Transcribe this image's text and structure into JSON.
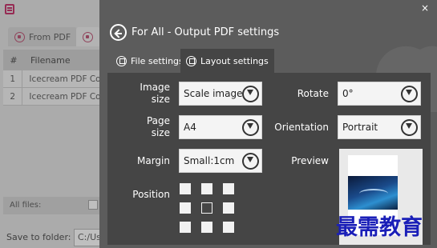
{
  "background_app": {
    "tabs": [
      {
        "label": "From PDF"
      },
      {
        "label": ""
      }
    ],
    "table": {
      "headers": [
        "#",
        "Filename"
      ],
      "rows": [
        {
          "num": "1",
          "name": "Icecream PDF Con"
        },
        {
          "num": "2",
          "name": "Icecream PDF Con"
        }
      ]
    },
    "all_files_label": "All files:",
    "save_to_folder_label": "Save to folder:",
    "save_path_value": "C:/Us"
  },
  "panel": {
    "title": "For All - Output PDF settings",
    "close_glyph": "×",
    "tabs": [
      {
        "label": "File settings",
        "active": false
      },
      {
        "label": "Layout settings",
        "active": true
      }
    ],
    "image_size": {
      "label": "Image size",
      "value": "Scale image"
    },
    "page_size": {
      "label": "Page size",
      "value": "A4"
    },
    "margin": {
      "label": "Margin",
      "value": "Small:1cm"
    },
    "rotate": {
      "label": "Rotate",
      "value": "0°"
    },
    "orientation": {
      "label": "Orientation",
      "value": "Portrait"
    },
    "preview_label": "Preview",
    "position_label": "Position",
    "position_selected": "middle-center"
  },
  "watermark": "最需教育",
  "colors": {
    "panel_bg": "#5c5c5c",
    "content_bg": "#454545",
    "accent": "#c93b70",
    "watermark": "#1a1fb8"
  }
}
